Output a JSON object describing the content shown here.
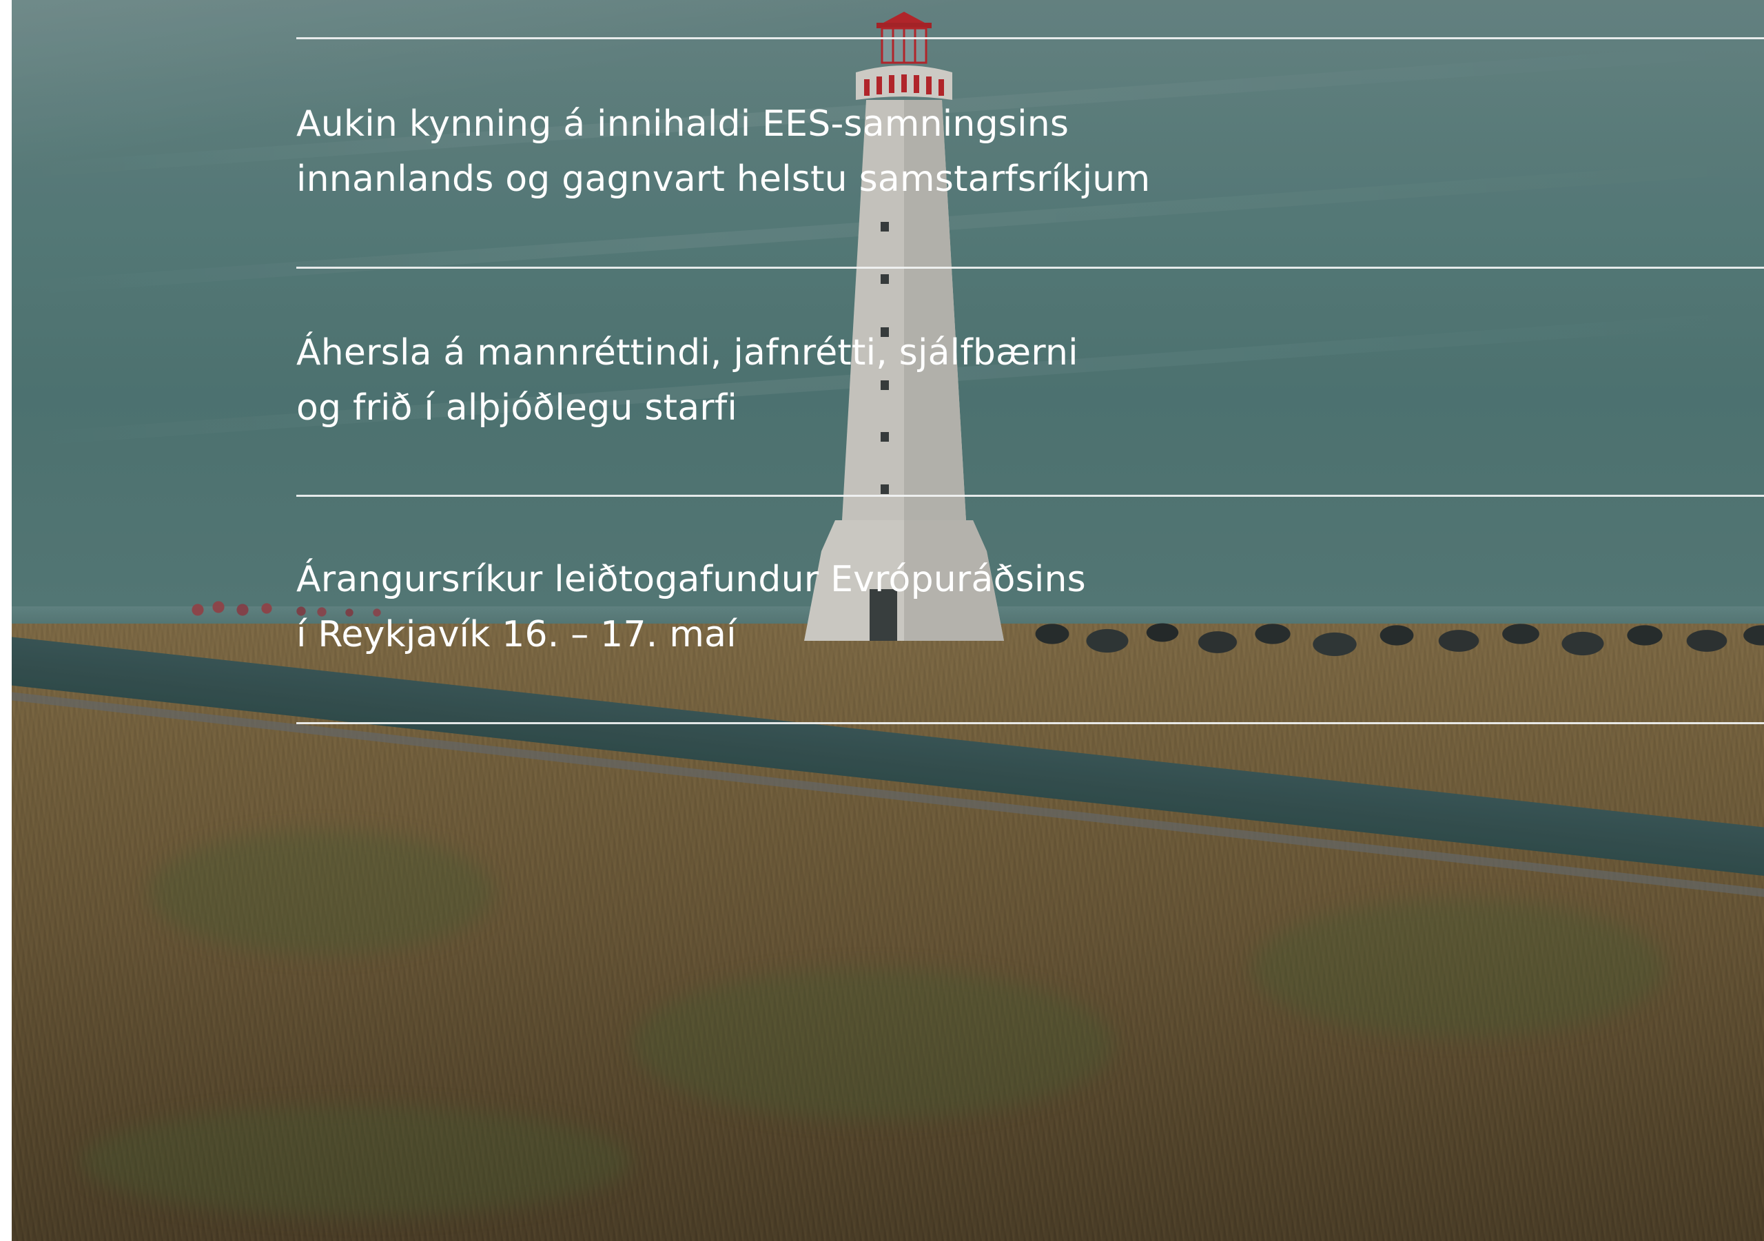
{
  "items": [
    {
      "line1": "Aukin kynning á innihaldi EES-samningsins",
      "line2": "innanlands og gagnvart helstu samstarfsríkjum"
    },
    {
      "line1": "Áhersla á mannréttindi, jafnrétti, sjálfbærni",
      "line2": "og frið í alþjóðlegu starfi"
    },
    {
      "line1": "Árangursríkur leiðtogafundur Evrópuráðsins",
      "line2": "í Reykjavík 16. – 17. maí"
    }
  ],
  "colors": {
    "text": "#ffffff",
    "divider": "#f2f4f4",
    "sky": "#5f8583",
    "grass": "#7e663f"
  }
}
